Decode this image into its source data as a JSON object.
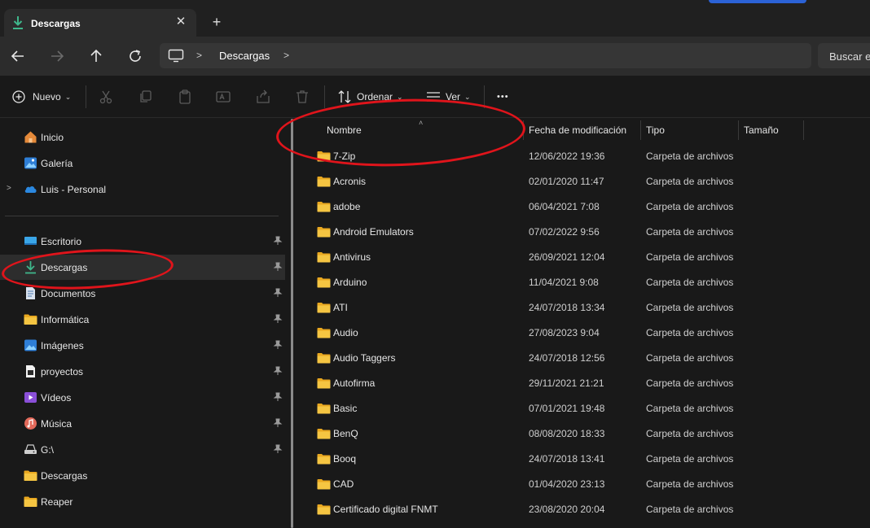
{
  "window": {
    "tab_title": "Descargas",
    "tab_close_glyph": "✕",
    "new_tab_glyph": "+"
  },
  "nav": {
    "back_icon": "arrow-left-icon",
    "forward_icon": "arrow-right-icon",
    "up_icon": "arrow-up-icon",
    "refresh_icon": "refresh-icon",
    "breadcrumb": [
      "Descargas"
    ],
    "search_placeholder": "Buscar e"
  },
  "toolbar": {
    "new_label": "Nuevo",
    "sort_label": "Ordenar",
    "view_label": "Ver",
    "more_glyph": "•••"
  },
  "sidebar": {
    "top_items": [
      {
        "label": "Inicio",
        "icon": "home-icon"
      },
      {
        "label": "Galería",
        "icon": "gallery-icon"
      },
      {
        "label": "Luis - Personal",
        "icon": "onedrive-cloud-icon"
      }
    ],
    "quick_access": [
      {
        "label": "Escritorio",
        "icon": "desktop-icon",
        "pinned": true
      },
      {
        "label": "Descargas",
        "icon": "download-icon",
        "pinned": true,
        "selected": true
      },
      {
        "label": "Documentos",
        "icon": "documents-icon",
        "pinned": true
      },
      {
        "label": "Informática",
        "icon": "folder-icon",
        "pinned": true
      },
      {
        "label": "Imágenes",
        "icon": "pictures-icon",
        "pinned": true
      },
      {
        "label": "proyectos",
        "icon": "project-file-icon",
        "pinned": true
      },
      {
        "label": "Vídeos",
        "icon": "videos-icon",
        "pinned": true
      },
      {
        "label": "Música",
        "icon": "music-icon",
        "pinned": true
      },
      {
        "label": "G:\\",
        "icon": "drive-icon",
        "pinned": true
      },
      {
        "label": "Descargas",
        "icon": "folder-icon",
        "pinned": false
      },
      {
        "label": "Reaper",
        "icon": "folder-icon",
        "pinned": false
      }
    ]
  },
  "columns": {
    "name": "Nombre",
    "modified": "Fecha de modificación",
    "type": "Tipo",
    "size": "Tamaño"
  },
  "files": [
    {
      "name": "7-Zip",
      "modified": "12/06/2022 19:36",
      "type": "Carpeta de archivos"
    },
    {
      "name": "Acronis",
      "modified": "02/01/2020 11:47",
      "type": "Carpeta de archivos"
    },
    {
      "name": "adobe",
      "modified": "06/04/2021 7:08",
      "type": "Carpeta de archivos"
    },
    {
      "name": "Android Emulators",
      "modified": "07/02/2022 9:56",
      "type": "Carpeta de archivos"
    },
    {
      "name": "Antivirus",
      "modified": "26/09/2021 12:04",
      "type": "Carpeta de archivos"
    },
    {
      "name": "Arduino",
      "modified": "11/04/2021 9:08",
      "type": "Carpeta de archivos"
    },
    {
      "name": "ATI",
      "modified": "24/07/2018 13:34",
      "type": "Carpeta de archivos"
    },
    {
      "name": "Audio",
      "modified": "27/08/2023 9:04",
      "type": "Carpeta de archivos"
    },
    {
      "name": "Audio Taggers",
      "modified": "24/07/2018 12:56",
      "type": "Carpeta de archivos"
    },
    {
      "name": "Autofirma",
      "modified": "29/11/2021 21:21",
      "type": "Carpeta de archivos"
    },
    {
      "name": "Basic",
      "modified": "07/01/2021 19:48",
      "type": "Carpeta de archivos"
    },
    {
      "name": "BenQ",
      "modified": "08/08/2020 18:33",
      "type": "Carpeta de archivos"
    },
    {
      "name": "Booq",
      "modified": "24/07/2018 13:41",
      "type": "Carpeta de archivos"
    },
    {
      "name": "CAD",
      "modified": "01/04/2020 23:13",
      "type": "Carpeta de archivos"
    },
    {
      "name": "Certificado digital FNMT",
      "modified": "23/08/2020 20:04",
      "type": "Carpeta de archivos"
    }
  ],
  "colors": {
    "accent_blue": "#2b62d6",
    "folder_yellow": "#f5c542",
    "download_green": "#3fb68b",
    "annotation_red": "#e0141b"
  }
}
